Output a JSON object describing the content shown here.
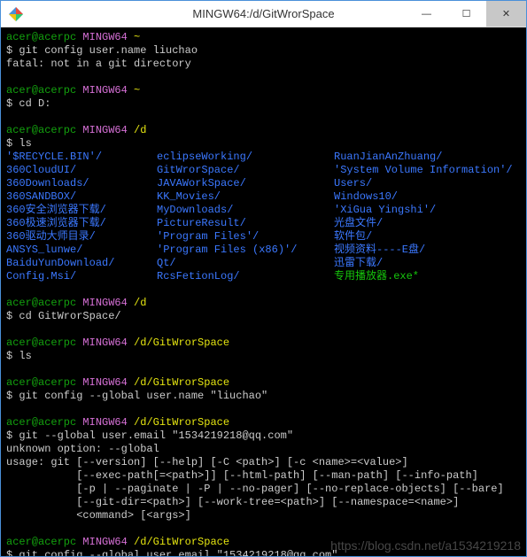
{
  "titlebar": {
    "title": "MINGW64:/d/GitWrorSpace",
    "minimize": "—",
    "maximize": "☐",
    "close": "✕"
  },
  "prompt": {
    "user": "acer@acerpc",
    "host": "MINGW64"
  },
  "blocks": [
    {
      "path": "~",
      "cmd": "git config user.name liuchao",
      "out": [
        "fatal: not in a git directory"
      ]
    },
    {
      "path": "~",
      "cmd": "cd D:"
    },
    {
      "path": "/d",
      "cmd": "ls",
      "ls": {
        "col0": [
          "'$RECYCLE.BIN'/",
          "360CloudUI/",
          "360Downloads/",
          "360SANDBOX/",
          "360安全浏览器下载/",
          "360极速浏览器下载/",
          "360驱动大师目录/",
          "ANSYS_lunwe/",
          "BaiduYunDownload/",
          "Config.Msi/"
        ],
        "col1": [
          "eclipseWorking/",
          "GitWrorSpace/",
          "JAVAWorkSpace/",
          "KK_Movies/",
          "MyDownloads/",
          "PictureResult/",
          "'Program Files'/",
          "'Program Files (x86)'/",
          "Qt/",
          "RcsFetionLog/"
        ],
        "col2": [
          "RuanJianAnZhuang/",
          "'System Volume Information'/",
          "Users/",
          "Windows10/",
          "'XiGua Yingshi'/",
          "光盘文件/",
          "软件包/",
          "视频资料----E盘/",
          "迅雷下载/"
        ],
        "col2_exe": "专用播放器.exe*"
      }
    },
    {
      "path": "/d",
      "cmd": "cd GitWrorSpace/"
    },
    {
      "path": "/d/GitWrorSpace",
      "cmd": "ls"
    },
    {
      "path": "/d/GitWrorSpace",
      "cmd": "git config --global user.name \"liuchao\""
    },
    {
      "path": "/d/GitWrorSpace",
      "cmd": "git --global user.email \"1534219218@qq.com\"",
      "out": [
        "unknown option: --global",
        "usage: git [--version] [--help] [-C <path>] [-c <name>=<value>]",
        "           [--exec-path[=<path>]] [--html-path] [--man-path] [--info-path]",
        "           [-p | --paginate | -P | --no-pager] [--no-replace-objects] [--bare]",
        "           [--git-dir=<path>] [--work-tree=<path>] [--namespace=<name>]",
        "           <command> [<args>]"
      ]
    },
    {
      "path": "/d/GitWrorSpace",
      "cmd": "git config --global user.email \"1534219218@qq.com\""
    }
  ],
  "watermark": "https://blog.csdn.net/a1534219218"
}
